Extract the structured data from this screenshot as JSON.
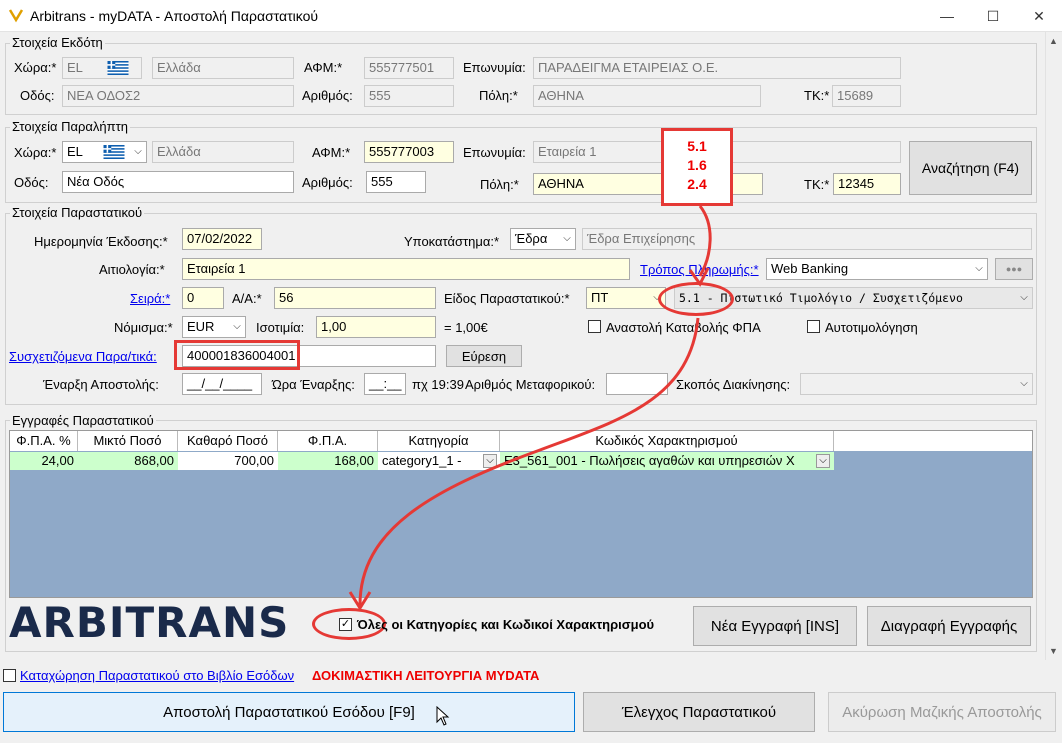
{
  "window": {
    "title": "Arbitrans - myDATA - Αποστολή Παραστατικού",
    "minimize": "—",
    "maximize": "☐",
    "close": "✕"
  },
  "issuer": {
    "legend": "Στοιχεία Εκδότη",
    "country_label": "Χώρα:*",
    "country_code": "EL",
    "country_name": "Ελλάδα",
    "afm_label": "ΑΦΜ:*",
    "afm": "555777501",
    "name_label": "Επωνυμία:",
    "name": "ΠΑΡΑΔΕΙΓΜΑ ΕΤΑΙΡΕΙΑΣ Ο.Ε.",
    "street_label": "Οδός:",
    "street": "ΝΕΑ ΟΔΟΣ2",
    "number_label": "Αριθμός:",
    "number": "555",
    "city_label": "Πόλη:*",
    "city": "ΑΘΗΝΑ",
    "zip_label": "ΤΚ:*",
    "zip": "15689"
  },
  "recipient": {
    "legend": "Στοιχεία Παραλήπτη",
    "country_label": "Χώρα:*",
    "country_code": "EL",
    "country_name": "Ελλάδα",
    "afm_label": "ΑΦΜ:*",
    "afm": "555777003",
    "name_label": "Επωνυμία:",
    "name": "Εταιρεία 1",
    "street_label": "Οδός:",
    "street": "Νέα Οδός",
    "number_label": "Αριθμός:",
    "number": "555",
    "city_label": "Πόλη:*",
    "city": "ΑΘΗΝΑ",
    "zip_label": "ΤΚ:*",
    "zip": "12345",
    "search_button": "Αναζήτηση (F4)"
  },
  "callout": {
    "line1": "5.1",
    "line2": "1.6",
    "line3": "2.4"
  },
  "document": {
    "legend": "Στοιχεία Παραστατικού",
    "issue_date_label": "Ημερομηνία Έκδοσης:*",
    "issue_date": "07/02/2022",
    "branch_label": "Υποκατάστημα:*",
    "branch": "Έδρα",
    "branch_desc": "Έδρα Επιχείρησης",
    "reason_label": "Αιτιολογία:*",
    "reason": "Εταιρεία 1",
    "payment_link": "Τρόπος Πληρωμής:*",
    "payment": "Web Banking",
    "payment_more": "●●●",
    "series_link": "Σειρά:*",
    "series": "0",
    "aa_label": "Α/Α:*",
    "aa": "56",
    "type_label": "Είδος Παραστατικού:*",
    "type_code": "ΠΤ",
    "type_desc": "5.1 - Πιστωτικό Τιμολόγιο / Συσχετιζόμενο",
    "currency_label": "Νόμισμα:*",
    "currency": "EUR",
    "rate_label": "Ισοτιμία:",
    "rate": "1,00",
    "rate_eq": "= 1,00€",
    "vat_suspend": "Αναστολή Καταβολής ΦΠΑ",
    "self_invoice": "Αυτοτιμολόγηση",
    "related_link": "Συσχετιζόμενα Παρα/τικά:",
    "related": "400001836004001",
    "find_button": "Εύρεση",
    "ship_start_label": "Έναρξη Αποστολής:",
    "ship_start": "__/__/____",
    "start_time_label": "Ώρα Έναρξης:",
    "start_time": "__:__",
    "time_hint": "πχ 19:39",
    "vehicle_label": "Αριθμός Μεταφορικού:",
    "vehicle": "",
    "move_purpose_label": "Σκοπός Διακίνησης:",
    "move_purpose": ""
  },
  "lines": {
    "legend": "Εγγραφές Παραστατικού",
    "columns": [
      "Φ.Π.Α. %",
      "Μικτό Ποσό",
      "Καθαρό Ποσό",
      "Φ.Π.Α.",
      "Κατηγορία",
      "Κωδικός Χαρακτηρισμού"
    ],
    "rows": [
      {
        "vat_pct": "24,00",
        "gross": "868,00",
        "net": "700,00",
        "vat": "168,00",
        "category": "category1_1  -",
        "code": "E3_561_001  -  Πωλήσεις αγαθών και υπηρεσιών Χ"
      }
    ]
  },
  "bottom": {
    "brand": "ARBITRANS",
    "all_categories": "Όλες οι Κατηγορίες και Κωδικοί Χαρακτηρισμού",
    "new_button": "Νέα Εγγραφή [INS]",
    "delete_button": "Διαγραφή Εγγραφής",
    "book_link": "Καταχώρηση Παραστατικού στο Βιβλίο Εσόδων",
    "test_mode": "ΔΟΚΙΜΑΣΤΙΚΗ ΛΕΙΤΟΥΡΓΙΑ MYDATA",
    "send_button": "Αποστολή Παραστατικού Εσόδου [F9]",
    "check_button": "Έλεγχος Παραστατικού",
    "cancel_button": "Ακύρωση Μαζικής Αποστολής"
  },
  "colors": {
    "accent_red": "#e53935",
    "required_yellow": "#ffffe1",
    "grid_bg": "#8fa9c8",
    "row_green": "#ccffcc",
    "brand_navy": "#1a2a4a"
  }
}
